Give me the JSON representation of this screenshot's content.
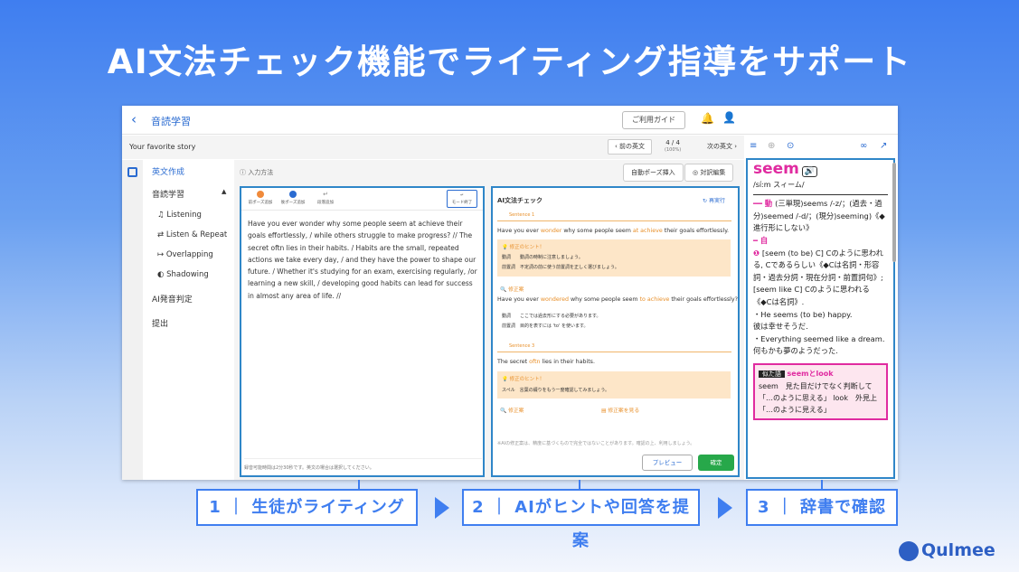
{
  "hero_title": "AI文法チェック機能でライティング指導をサポート",
  "app": {
    "back": "‹",
    "title": "音読学習",
    "guide": "ご利用ガイド",
    "story": "Your favorite story",
    "prev": "‹ 前の英文",
    "pager": "4 / 4",
    "pager_sub": "(100%)",
    "next": "次の英文 ›"
  },
  "sidebar": {
    "items": [
      {
        "label": "英文作成",
        "active": true
      },
      {
        "label": "音読学習"
      },
      {
        "label": "Listening"
      },
      {
        "label": "Listen & Repeat"
      },
      {
        "label": "Overlapping"
      },
      {
        "label": "Shadowing"
      },
      {
        "label": "AI発音判定"
      },
      {
        "label": "提出"
      }
    ]
  },
  "main": {
    "howto": "入力方法",
    "pause_btn": "自動ポーズ挿入",
    "edit_btn": "対訳編集"
  },
  "editor": {
    "tools": [
      "前ポーズ追加",
      "後ポーズ追加",
      "段落追加"
    ],
    "mode_btn": "モード終了",
    "text": "Have you ever wonder why some people seem at achieve their goals effortlessly, / while others struggle to make progress? // The secret oftn lies in their habits. / Habits are the small, repeated actions we take every day, / and they have the power to shape our future. / Whether it's studying for an exam, exercising regularly, /or learning a new skill, / developing good habits can lead for success in almost any area of life. //",
    "note": "録音可能時間は2分30秒です。英文の場合は選択してください。"
  },
  "check": {
    "title": "AI文法チェック",
    "rerun": "再実行",
    "s1_label": "Sentence 1",
    "s1_a": "Have you ever ",
    "s1_b": "wonder",
    "s1_c": " why some people seem ",
    "s1_d": "at achieve",
    "s1_e": " their goals effortlessly.",
    "hint_label": "修正のヒント！",
    "h1_r1": "動詞　　動詞の時制に注意しましょう。",
    "h1_r2": "前置詞　不定詞の前に使う前置詞を正しく選びましょう。",
    "fix_label": "修正案",
    "f1_a": "Have you ever ",
    "f1_b": "wondered",
    "f1_c": " why some people seem ",
    "f1_d": "to achieve",
    "f1_e": " their goals effortlessly?",
    "f1_r1": "動詞　　ここでは過去形にする必要があります。",
    "f1_r2": "前置詞　目的を表すには 'to' を使います。",
    "s3_label": "Sentence 3",
    "s3_a": "The secret ",
    "s3_b": "oftn",
    "s3_c": " lies in their habits.",
    "h3_r1": "スペル　言葉の綴りをもう一度確認してみましょう。",
    "view_fix": "修正案を見る",
    "disclaimer": "※AIの修正案は、精度に基づくもので完全ではないことがあります。確認の上、利用しましょう。",
    "preview": "プレビュー",
    "confirm": "確定"
  },
  "dict": {
    "word": "seem",
    "pron": "/síːm スィーム/",
    "l1": "(三単現)seems /-z/；(過去・過分)seemed /-d/；(現分)seeming)《◆進行形にしない》",
    "sense": "[seem (to be) C] Cのように思われる, Cであるらしい《◆Cは名詞・形容詞・過去分詞・現在分詞・前置詞句》;[seem like C] Cのように思われる《◆Cは名詞》.",
    "ex1_en": "・He seems (to be) happy.",
    "ex1_ja": "彼は幸せそうだ.",
    "ex2_en": "・Everything seemed like a dream.",
    "ex2_ja": "何もかも夢のようだった.",
    "rel_tag": "似た語",
    "rel_title": "seemとlook",
    "rel_body": "seem　見た目だけでなく判断して「…のように思える」 look　外見上「…のように見える」"
  },
  "steps": [
    "1 ｜ 生徒がライティング",
    "2 ｜ AIがヒントや回答を提案",
    "3 ｜ 辞書で確認"
  ],
  "logo": "Qulmee"
}
